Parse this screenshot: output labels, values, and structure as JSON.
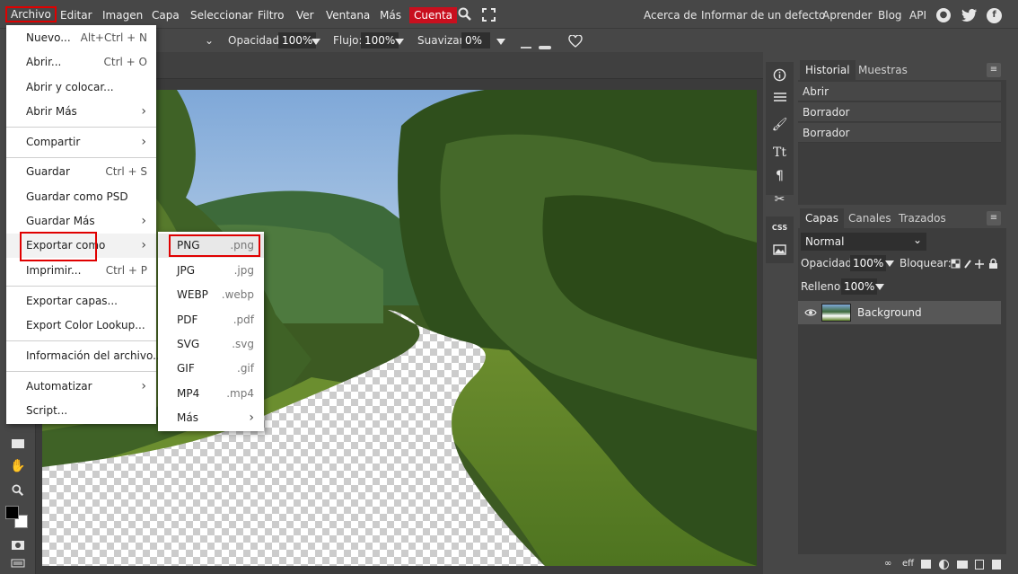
{
  "menubar": {
    "items": [
      {
        "label": "Archivo"
      },
      {
        "label": "Editar"
      },
      {
        "label": "Imagen"
      },
      {
        "label": "Capa"
      },
      {
        "label": "Seleccionar"
      },
      {
        "label": "Filtro"
      },
      {
        "label": "Ver"
      },
      {
        "label": "Ventana"
      },
      {
        "label": "Más"
      },
      {
        "label": "Cuenta"
      }
    ],
    "right_links": [
      {
        "label": "Acerca de"
      },
      {
        "label": "Informar de un defecto"
      },
      {
        "label": "Aprender"
      },
      {
        "label": "Blog"
      },
      {
        "label": "API"
      }
    ],
    "social_icons": [
      "reddit-icon",
      "twitter-icon",
      "facebook-icon"
    ]
  },
  "options_bar": {
    "opacity_label": "Opacidad:",
    "opacity_value": "100%",
    "flow_label": "Flujo:",
    "flow_value": "100%",
    "smooth_label": "Suavizar:",
    "smooth_value": "0%"
  },
  "file_menu": {
    "items": [
      {
        "label": "Nuevo...",
        "shortcut": "Alt+Ctrl + N"
      },
      {
        "label": "Abrir...",
        "shortcut": "Ctrl + O"
      },
      {
        "label": "Abrir y colocar..."
      },
      {
        "label": "Abrir Más",
        "submenu": true
      },
      {
        "label": "Compartir",
        "submenu": true
      },
      {
        "label": "Guardar",
        "shortcut": "Ctrl + S"
      },
      {
        "label": "Guardar como PSD"
      },
      {
        "label": "Guardar Más",
        "submenu": true
      },
      {
        "label": "Exportar como",
        "submenu": true
      },
      {
        "label": "Imprimir...",
        "shortcut": "Ctrl + P"
      },
      {
        "label": "Exportar capas..."
      },
      {
        "label": "Export Color Lookup..."
      },
      {
        "label": "Información del archivo..."
      },
      {
        "label": "Automatizar",
        "submenu": true
      },
      {
        "label": "Script..."
      }
    ]
  },
  "export_submenu": {
    "items": [
      {
        "label": "PNG",
        "ext": ".png"
      },
      {
        "label": "JPG",
        "ext": ".jpg"
      },
      {
        "label": "WEBP",
        "ext": ".webp"
      },
      {
        "label": "PDF",
        "ext": ".pdf"
      },
      {
        "label": "SVG",
        "ext": ".svg"
      },
      {
        "label": "GIF",
        "ext": ".gif"
      },
      {
        "label": "MP4",
        "ext": ".mp4"
      },
      {
        "label": "Más",
        "ext": ""
      }
    ]
  },
  "history_panel": {
    "tabs": [
      "Historial",
      "Muestras"
    ],
    "entries": [
      "Abrir",
      "Borrador",
      "Borrador"
    ]
  },
  "layers_panel": {
    "tabs": [
      "Capas",
      "Canales",
      "Trazados"
    ],
    "blend_mode": "Normal",
    "opacity_label": "Opacidad:",
    "opacity_value": "100%",
    "lock_label": "Bloquear:",
    "fill_label": "Relleno:",
    "fill_value": "100%",
    "layers": [
      {
        "name": "Background"
      }
    ],
    "footer_eff": "eff"
  },
  "colors": {
    "accent_red": "#c80f1e",
    "highlight_red": "#e00000",
    "ui_gray": "#474747",
    "panel_gray": "#3d3d3d",
    "menu_bg": "#ffffff"
  }
}
